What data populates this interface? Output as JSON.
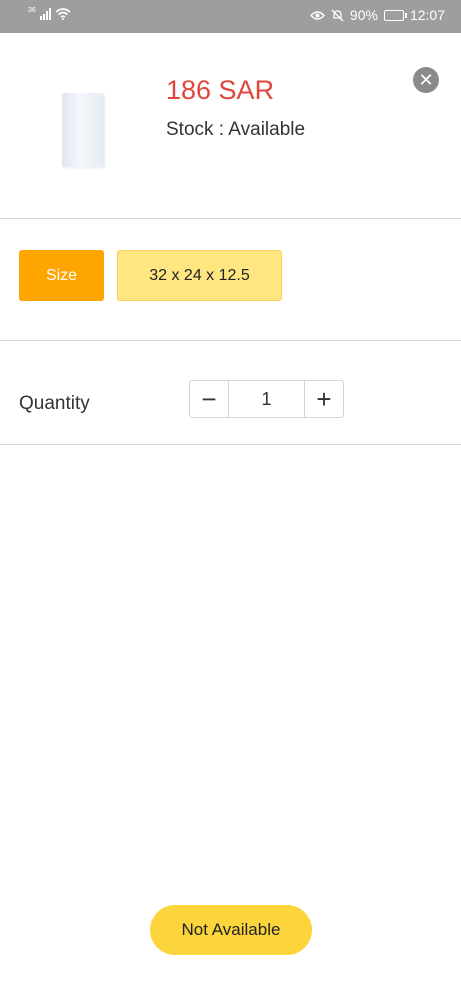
{
  "status_bar": {
    "network": "36",
    "battery": "90%",
    "battery_level": 0.9,
    "time": "12:07"
  },
  "product": {
    "price": "186 SAR",
    "stock": "Stock : Available",
    "image_icon": "paper-bag-image"
  },
  "size": {
    "label": "Size",
    "selected_option": "32 x 24 x 12.5"
  },
  "quantity": {
    "label": "Quantity",
    "decrement": "−",
    "value": "1",
    "increment": "+"
  },
  "actions": {
    "close": "✕",
    "cta_label": "Not Available"
  },
  "colors": {
    "price": "#e0463b",
    "size_label_bg": "#ffa500",
    "size_option_bg": "#ffe680",
    "cta_bg": "#fcd53c"
  }
}
